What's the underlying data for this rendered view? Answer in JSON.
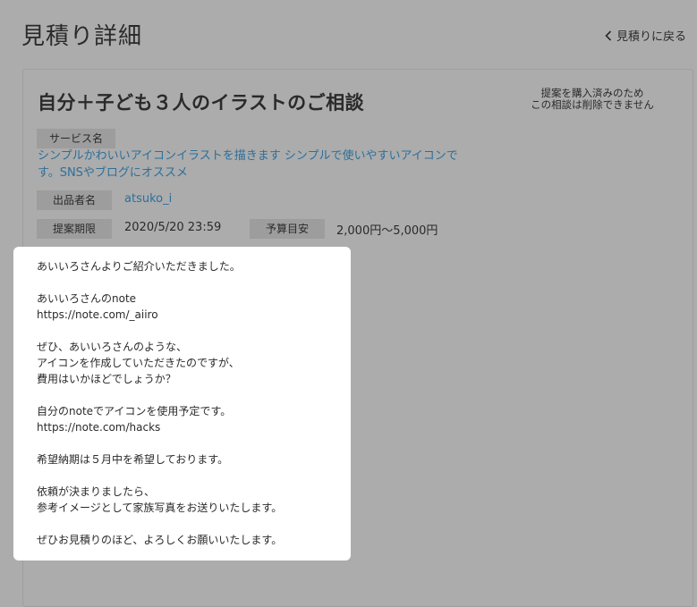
{
  "header": {
    "title": "見積り詳細",
    "back_label": "見積りに戻る"
  },
  "request": {
    "title": "自分＋子ども３人のイラストのご相談",
    "notice_lines": [
      "提案を購入済みのため",
      "この相談は削除できません"
    ],
    "service_label": "サービス名",
    "service_name": "シンプルかわいいアイコンイラストを描きます シンプルで使いやすいアイコンです。SNSやブログにオススメ",
    "seller_label": "出品者名",
    "seller_name": "atsuko_i",
    "deadline_label": "提案期限",
    "deadline_value": "2020/5/20 23:59",
    "budget_label": "予算目安",
    "budget_value": "2,000円〜5,000円"
  },
  "message": {
    "lines": [
      "あいいろさんよりご紹介いただきました。",
      "",
      "あいいろさんのnote",
      "https://note.com/_aiiro",
      "",
      "ぜひ、あいいろさんのような、",
      "アイコンを作成していただきたのですが、",
      "費用はいかほどでしょうか？",
      "",
      "自分のnoteでアイコンを使用予定です。",
      "https://note.com/hacks",
      "",
      "希望納期は５月中を希望しております。",
      "",
      "依頼が決まりましたら、",
      "参考イメージとして家族写真をお送りいたします。",
      "",
      "ぜひお見積りのほど、よろしくお願いいたします。"
    ]
  }
}
